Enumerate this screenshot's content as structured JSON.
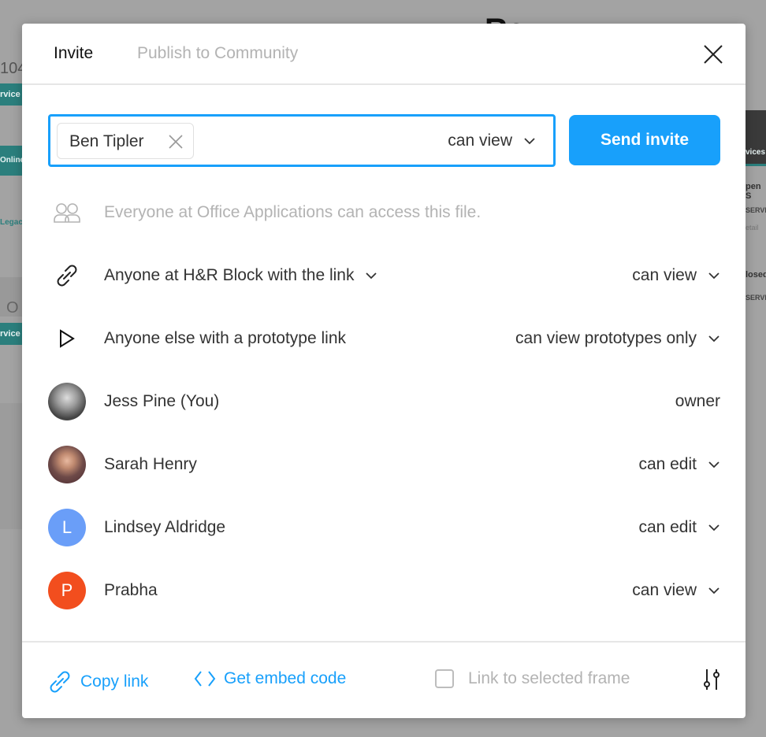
{
  "background": {
    "fragments": [
      "104",
      "rvice",
      "Online",
      "Legacy",
      "O",
      "rvice",
      "vices",
      "pen S",
      "SERVIC",
      "etail",
      "losed",
      "SERVIC",
      "Rev"
    ]
  },
  "tabs": [
    {
      "label": "Invite",
      "active": true
    },
    {
      "label": "Publish to Community",
      "active": false
    }
  ],
  "invite": {
    "chip": "Ben Tipler",
    "permission": "can view",
    "send_label": "Send invite"
  },
  "org_notice": "Everyone at Office Applications can access this file.",
  "link_rows": [
    {
      "icon": "link-icon",
      "label": "Anyone at H&R Block with the link",
      "permission": "can view"
    },
    {
      "icon": "play-icon",
      "label": "Anyone else with a prototype link",
      "permission": "can view prototypes only"
    }
  ],
  "members": [
    {
      "name": "Jess Pine (You)",
      "role": "owner",
      "avatar": "photo",
      "color": "#555555"
    },
    {
      "name": "Sarah Henry",
      "role": "can edit",
      "avatar": "photo",
      "color": "#6e4a48"
    },
    {
      "name": "Lindsey Aldridge",
      "role": "can edit",
      "avatar": "L",
      "color": "#6a9ef8"
    },
    {
      "name": "Prabha",
      "role": "can view",
      "avatar": "P",
      "color": "#f24e1e"
    }
  ],
  "footer": {
    "copy_link": "Copy link",
    "embed": "Get embed code",
    "frame_checkbox": "Link to selected frame",
    "frame_checked": false
  },
  "colors": {
    "accent": "#18a0fb"
  }
}
